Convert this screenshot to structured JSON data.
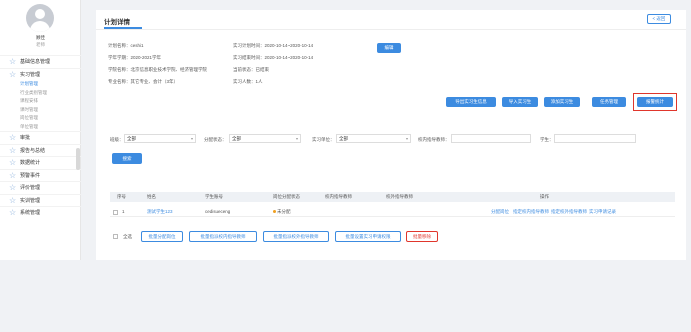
{
  "user": {
    "name": "顾佳",
    "role": "老师"
  },
  "sidebar": {
    "items": [
      {
        "label": "基础信息管理"
      },
      {
        "label": "实习管理"
      },
      {
        "label": "审批"
      },
      {
        "label": "报告与总结"
      },
      {
        "label": "数据统计"
      },
      {
        "label": "预警事件"
      },
      {
        "label": "评价管理"
      },
      {
        "label": "实训管理"
      },
      {
        "label": "系统管理"
      }
    ],
    "sub_items": [
      {
        "label": "计划管理"
      },
      {
        "label": "行业类别管理"
      },
      {
        "label": "课程安排"
      },
      {
        "label": "课时管理"
      },
      {
        "label": "岗位管理"
      },
      {
        "label": "单位管理"
      }
    ]
  },
  "page": {
    "title": "计划详情",
    "back_label": "< 返回",
    "edit_label": "编辑"
  },
  "info": {
    "plan_name": "计划名称：ceshi1",
    "semester": "学年学期：2020-2021学年",
    "school": "学院名称：北京信息职业技术学院、经济管理学院",
    "major": "专业名称：其它专业、会计（3年）",
    "plan_time": "实习计划时间：2020-10-14~2020-10-14",
    "actual_time": "实习结束时间：2020-10-14~2020-10-14",
    "status": "当前状态：已结束",
    "count": "实习人数：1人"
  },
  "actions": [
    {
      "label": "导出实习生信息"
    },
    {
      "label": "导入实习生"
    },
    {
      "label": "添加实习生"
    },
    {
      "label": "任务管理"
    },
    {
      "label": "报警统计"
    }
  ],
  "filters": {
    "class_label": "班级：",
    "class_value": "全部",
    "assign_label": "分配状态：",
    "assign_value": "全部",
    "unit_label": "实习单位：",
    "unit_value": "全部",
    "teacher_label": "校内指导教师：",
    "student_label": "学生：",
    "search_label": "搜索"
  },
  "table": {
    "headers": [
      "序号",
      "姓名",
      "学生账号",
      "岗位分配状态",
      "校内指导教师",
      "校外指导教师",
      "操作"
    ],
    "rows": [
      {
        "index": "1",
        "name": "测试学生123",
        "account": "cedisueceng",
        "status": "未分配",
        "inner_teacher": "",
        "outer_teacher": "",
        "ops": [
          "分配岗位",
          "指定校内指导教师",
          "指定校外指导教师",
          "实习申请记录"
        ]
      }
    ]
  },
  "bottom": {
    "select_all": "全选",
    "buttons": [
      {
        "label": "批量分配岗位"
      },
      {
        "label": "批量指派校内指导教师"
      },
      {
        "label": "批量指派校外指导教师"
      },
      {
        "label": "批量设置实习申请权限"
      },
      {
        "label": "批量移除"
      }
    ]
  },
  "colors": {
    "accent": "#3c8be0",
    "danger": "#e0362c",
    "warning": "#f0a020"
  }
}
